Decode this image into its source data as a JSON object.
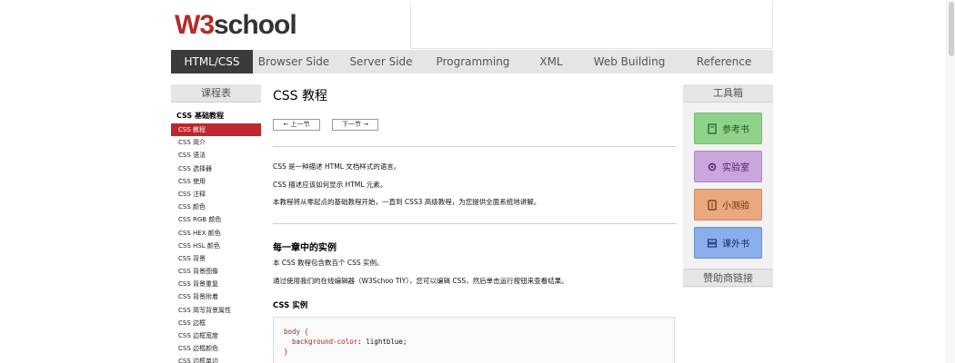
{
  "logo": {
    "w3": "W3",
    "rest": "school"
  },
  "nav": {
    "items": [
      "HTML/CSS",
      "Browser Side",
      "Server Side",
      "Programming",
      "XML",
      "Web Building",
      "Reference"
    ]
  },
  "left_sidebar": {
    "title": "课程表",
    "heading": "CSS 基础教程",
    "items": [
      "CSS 教程",
      "CSS 简介",
      "CSS 语法",
      "CSS 选择器",
      "CSS 使用",
      "CSS 注释",
      "CSS 颜色",
      "CSS RGB 颜色",
      "CSS HEX 颜色",
      "CSS HSL 颜色",
      "CSS 背景",
      "CSS 背景图像",
      "CSS 背景重复",
      "CSS 背景附着",
      "CSS 简写背景属性",
      "CSS 边框",
      "CSS 边框宽度",
      "CSS 边框颜色",
      "CSS 边框单边"
    ]
  },
  "main": {
    "title": "CSS 教程",
    "prev_label": "上一节",
    "next_label": "下一节",
    "intro": [
      "CSS 是一种描述 HTML 文档样式的语言。",
      "CSS 描述应该如何显示 HTML 元素。",
      "本教程将从零起点的基础教程开始，一直到 CSS3 高级教程，为您提供全面系统地讲解。"
    ],
    "section_title": "每一章中的实例",
    "section_paras": [
      "本 CSS 教程包含数百个 CSS 实例。",
      "通过使用我们的在线编辑器（W3Schoo TIY），您可以编辑 CSS，然后单击运行按钮来查看结果。"
    ],
    "example_title": "CSS 实例",
    "code": {
      "selector": "body",
      "open": "{",
      "property": "background-color",
      "value": "lightblue;",
      "close": "}"
    }
  },
  "right_sidebar": {
    "title": "工具箱",
    "tools": [
      {
        "label": "参考书",
        "color": "#8fd38b",
        "icon": "book-icon"
      },
      {
        "label": "实验室",
        "color": "#c9a6dd",
        "icon": "gear-icon"
      },
      {
        "label": "小测验",
        "color": "#eba77d",
        "icon": "quiz-icon"
      },
      {
        "label": "课外书",
        "color": "#8aadec",
        "icon": "server-icon"
      }
    ],
    "sponsor_title": "赞助商链接"
  }
}
